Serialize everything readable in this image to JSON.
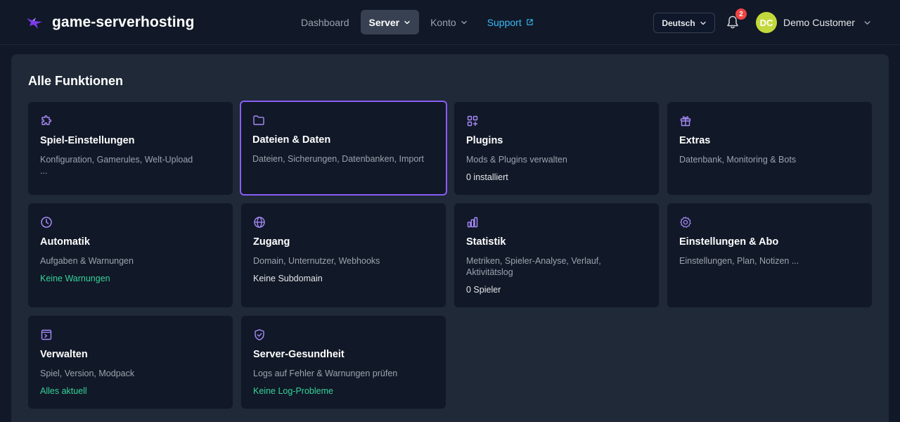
{
  "brand": {
    "name": "game-serverhosting",
    "logo_icon": "dragon-logo-icon"
  },
  "nav": {
    "items": [
      {
        "label": "Dashboard"
      },
      {
        "label": "Server"
      },
      {
        "label": "Konto"
      },
      {
        "label": "Support"
      }
    ],
    "active": "Server"
  },
  "header": {
    "language": "Deutsch",
    "notifications_count": "2",
    "user_initials": "DC",
    "user_name": "Demo Customer"
  },
  "main": {
    "title": "Alle Funktionen",
    "cards": [
      {
        "icon": "puzzle-icon",
        "title": "Spiel-Einstellungen",
        "description": "Konfiguration, Gamerules, Welt-Upload ...",
        "status": ""
      },
      {
        "icon": "folder-icon",
        "title": "Dateien & Daten",
        "description": "Dateien, Sicherungen, Datenbanken, Import",
        "status": ""
      },
      {
        "icon": "apps-add-icon",
        "title": "Plugins",
        "description": "Mods & Plugins verwalten",
        "status": "0 installiert"
      },
      {
        "icon": "gift-icon",
        "title": "Extras",
        "description": "Datenbank, Monitoring & Bots",
        "status": ""
      },
      {
        "icon": "clock-icon",
        "title": "Automatik",
        "description": "Aufgaben & Warnungen",
        "status": "Keine Warnungen"
      },
      {
        "icon": "globe-icon",
        "title": "Zugang",
        "description": "Domain, Unternutzer, Webhooks",
        "status": "Keine Subdomain"
      },
      {
        "icon": "bar-chart-icon",
        "title": "Statistik",
        "description": "Metriken, Spieler-Analyse, Verlauf, Aktivitätslog",
        "status": "0 Spieler"
      },
      {
        "icon": "gear-icon",
        "title": "Einstellungen & Abo",
        "description": "Einstellungen, Plan, Notizen ...",
        "status": ""
      },
      {
        "icon": "terminal-window-icon",
        "title": "Verwalten",
        "description": "Spiel, Version, Modpack",
        "status": "Alles aktuell"
      },
      {
        "icon": "shield-check-icon",
        "title": "Server-Gesundheit",
        "description": "Logs auf Fehler & Warnungen prüfen",
        "status": "Keine Log-Probleme"
      }
    ]
  },
  "colors": {
    "background": "#111827",
    "panel": "#1f2937",
    "accent": "#8b5cf6",
    "success": "#34d399",
    "link": "#38bdf8",
    "badge": "#ef4444",
    "avatar": "#c3d83b"
  }
}
